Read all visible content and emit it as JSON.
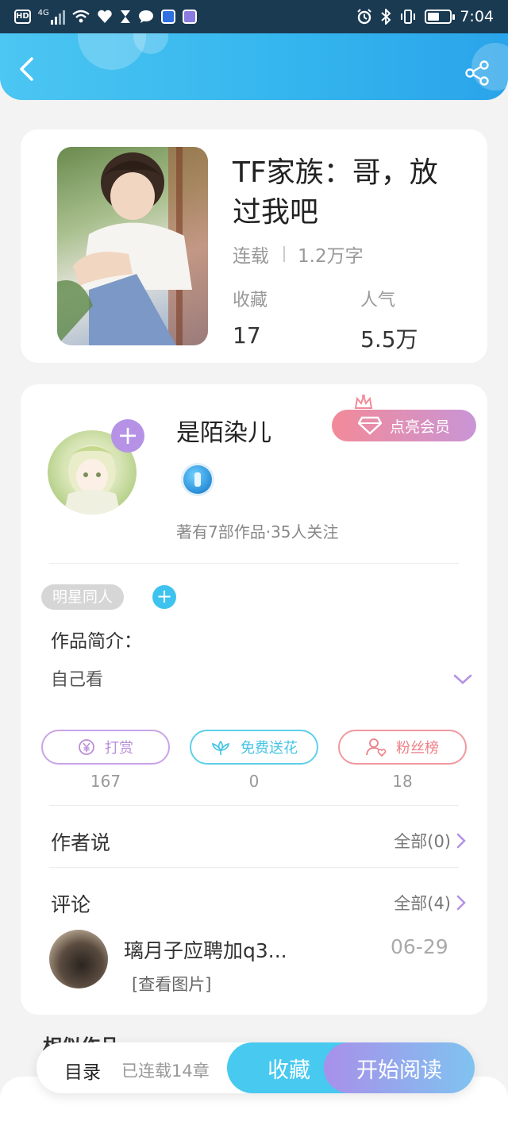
{
  "status_bar": {
    "network_label": "HD",
    "signal_label": "4G",
    "time": "7:04",
    "battery_level": 0.55
  },
  "header": {
    "back_icon": "chevron-left-icon",
    "share_icon": "share-icon"
  },
  "book": {
    "title": "TF家族：哥，放过我吧",
    "status": "连载",
    "word_count": "1.2万字",
    "stats": [
      {
        "label": "收藏",
        "value": "17"
      },
      {
        "label": "人气",
        "value": "5.5万"
      }
    ]
  },
  "author": {
    "name": "是陌染儿",
    "follow_label": "+",
    "vip_label": "点亮会员",
    "meta": "著有7部作品·35人关注"
  },
  "tags": {
    "items": [
      "明星同人"
    ],
    "add_label": "+"
  },
  "intro": {
    "title": "作品简介：",
    "text": "自己看"
  },
  "actions": [
    {
      "label": "打赏",
      "icon": "yen-coin-icon",
      "count": "167",
      "color": "#b98ed8"
    },
    {
      "label": "免费送花",
      "icon": "flower-icon",
      "count": "0",
      "color": "#47c4e6"
    },
    {
      "label": "粉丝榜",
      "icon": "user-heart-icon",
      "count": "18",
      "color": "#ee7f86"
    }
  ],
  "author_says": {
    "title": "作者说",
    "all_label": "全部(0)"
  },
  "comments": {
    "title": "评论",
    "all_label": "全部(4)",
    "items": [
      {
        "text": "璃月子应聘加q3...",
        "date": "06-29",
        "image_link": "[查看图片]"
      }
    ]
  },
  "similar": {
    "title": "相似作品"
  },
  "bottom_bar": {
    "toc_label": "目录",
    "chapters_label": "已连载14章",
    "favorite_label": "收藏",
    "read_label": "开始阅读"
  },
  "colors": {
    "header_gradient_start": "#4cc6f2",
    "header_gradient_end": "#2aa4ea",
    "accent_purple": "#b592e6",
    "accent_blue": "#48c9ef",
    "vip_pink": "#f28a99"
  }
}
